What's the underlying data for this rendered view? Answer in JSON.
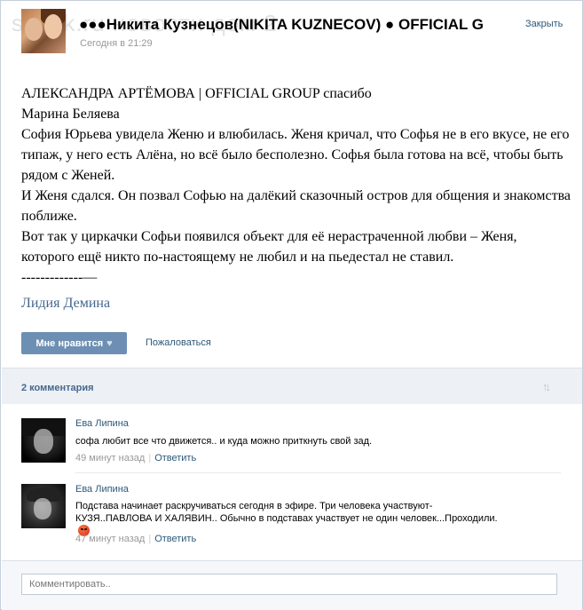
{
  "header": {
    "watermark": "s/lock.ru    новости дом 2",
    "group_name": "●●●Никита Кузнецов(NIKITA KUZNECOV) ● OFFICIAL G",
    "time": "Сегодня в 21:29",
    "close_label": "Закрыть"
  },
  "post": {
    "lines": [
      "АЛЕКСАНДРА АРТЁМОВА | OFFICIAL GROUP спасибо",
      "Марина Беляева",
      "София Юрьева увидела Женю и влюбилась. Женя кричал, что Софья не в его вкусе, не его типаж, у него есть Алёна, но всё было бесполезно. Софья была готова на всё, чтобы быть рядом с Женей.",
      "И Женя сдался. Он позвал Софью на далёкий сказочный остров для общения и знакомства поближе.",
      "Вот так у циркачки Софьи появился объект для её нерастраченной любви – Женя, которого ещё никто по-настоящему не любил и на пьедестал не ставил.",
      "-------------—"
    ],
    "author": "Лидия Демина"
  },
  "actions": {
    "like_label": "Мне нравится",
    "heart_icon": "heart-icon",
    "complain_label": "Пожаловаться"
  },
  "comments_header": {
    "count_label": "2 комментария",
    "sort_icon": "sort-arrows-icon"
  },
  "comments": [
    {
      "author": "Ева Липина",
      "text": "софа любит все что движется.. и куда можно приткнуть свой зад.",
      "time": "49 минут назад",
      "reply": "Ответить"
    },
    {
      "author": "Ева Липина",
      "text": "Подстава начинает раскручиваться сегодня в эфире. Три человека участвуют-КУЗЯ..ПАВЛОВА И ХАЛЯВИН.. Обычно в подставах участвует не один человек...Проходили.",
      "time": "47 минут назад",
      "reply": "Ответить",
      "emoji_icon": "angry-face-icon"
    }
  ],
  "footer": {
    "input_placeholder": "Комментировать.."
  }
}
